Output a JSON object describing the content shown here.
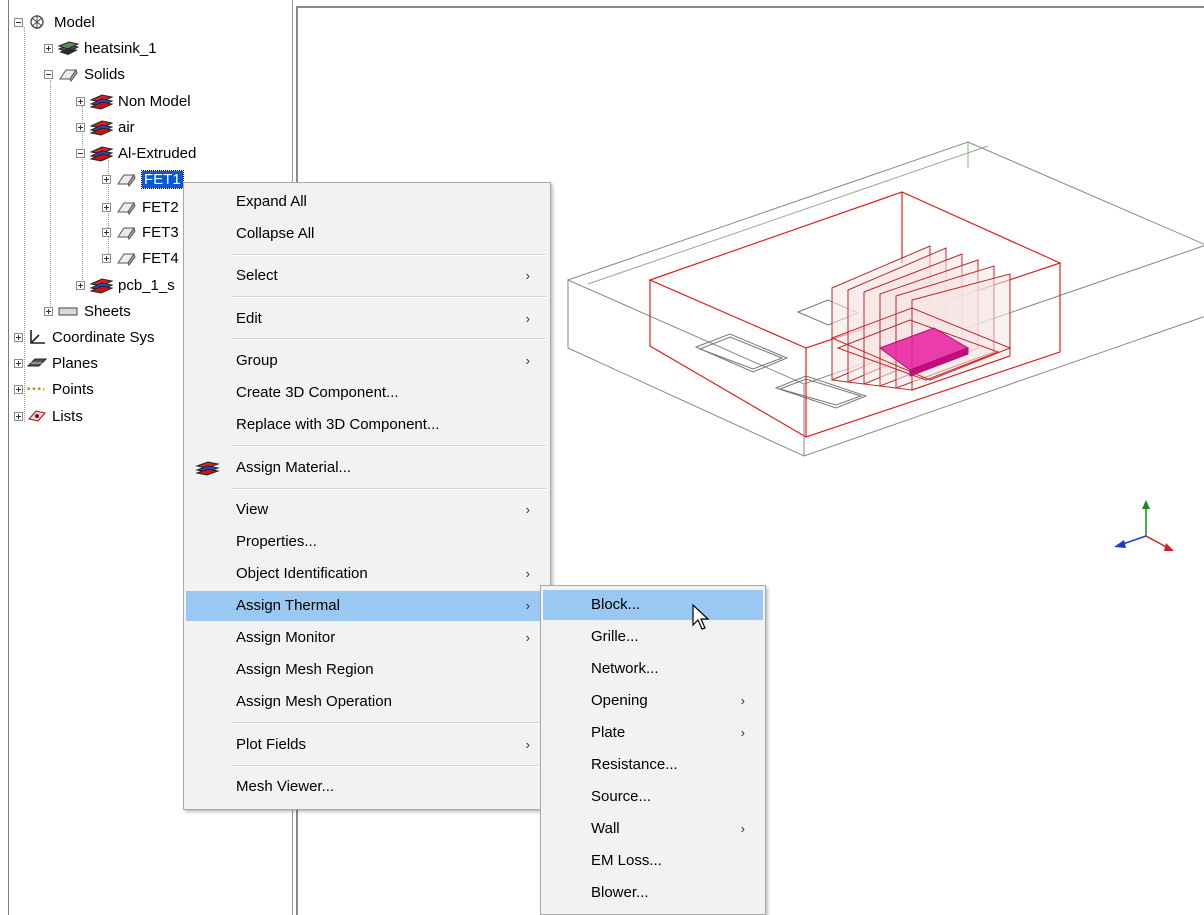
{
  "tree": {
    "model": "Model",
    "heatsink": "heatsink_1",
    "solids": "Solids",
    "non_model": "Non Model",
    "air": "air",
    "al_extruded": "Al-Extruded",
    "fet1": "FET1",
    "fet2": "FET2",
    "fet3": "FET3",
    "fet4": "FET4",
    "pcb": "pcb_1_s",
    "sheets": "Sheets",
    "coordinate_systems": "Coordinate Sys",
    "planes": "Planes",
    "points": "Points",
    "lists": "Lists"
  },
  "context_menu": {
    "expand_all": "Expand All",
    "collapse_all": "Collapse All",
    "select": "Select",
    "edit": "Edit",
    "group": "Group",
    "create_3d": "Create 3D Component...",
    "replace_3d": "Replace with 3D Component...",
    "assign_material": "Assign Material...",
    "view": "View",
    "properties": "Properties...",
    "object_identification": "Object Identification",
    "assign_thermal": "Assign Thermal",
    "assign_monitor": "Assign Monitor",
    "assign_mesh_region": "Assign Mesh Region",
    "assign_mesh_operation": "Assign Mesh Operation",
    "plot_fields": "Plot Fields",
    "mesh_viewer": "Mesh Viewer..."
  },
  "thermal_submenu": {
    "block": "Block...",
    "grille": "Grille...",
    "network": "Network...",
    "opening": "Opening",
    "plate": "Plate",
    "resistance": "Resistance...",
    "source": "Source...",
    "wall": "Wall",
    "em_loss": "EM Loss...",
    "blower": "Blower..."
  },
  "colors": {
    "selection": "#0a58d8",
    "menu_highlight": "#99c9f3",
    "model_outline": "#e02020",
    "region_outline": "#777777",
    "fet_fill": "#e81ea0"
  }
}
